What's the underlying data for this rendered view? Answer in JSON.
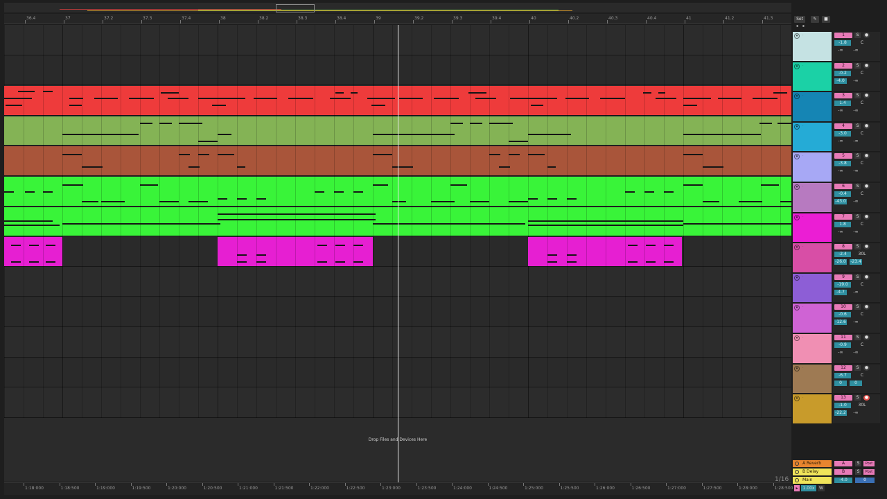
{
  "colors": {
    "accent_pink": "#e87ab7",
    "volume_teal": "#2f8fa0",
    "playhead": "#e8e8e8"
  },
  "ruler": {
    "beat_labels": [
      "36.4",
      "37",
      "37.2",
      "37.3",
      "37.4",
      "38",
      "38.2",
      "38.3",
      "38.4",
      "39",
      "39.2",
      "39.3",
      "39.4",
      "40",
      "40.2",
      "40.3",
      "40.4",
      "41",
      "41.2",
      "41.3"
    ],
    "time_labels": [
      "1:18:000",
      "1:18:500",
      "1:19:000",
      "1:19:500",
      "1:20:000",
      "1:20:500",
      "1:21:000",
      "1:21:500",
      "1:22:000",
      "1:22:500",
      "1:23:000",
      "1:23:500",
      "1:24:000",
      "1:24:500",
      "1:25:000",
      "1:25:500",
      "1:26:000",
      "1:26:500",
      "1:27:000",
      "1:27:500",
      "1:28:000",
      "1:28:500"
    ],
    "controls": {
      "set_label": "Set",
      "icon_1": "pencil-icon",
      "icon_2": "lock-icon"
    }
  },
  "arrangement": {
    "drop_hint": "Drop Files and Devices Here",
    "zoom_label": "1/16"
  },
  "tracks": [
    {
      "number": "1",
      "solo": "S",
      "volume": "-1.8",
      "pan": "C",
      "send_a": "-∞",
      "send_b": "-∞",
      "color": "#c5e2e3",
      "clip_color": null,
      "armed": false
    },
    {
      "number": "2",
      "solo": "S",
      "volume": "-0.2",
      "pan": "C",
      "send_a": "-4.0",
      "send_b": "-∞",
      "color": "#1bd1a6",
      "clip_color": null,
      "armed": false
    },
    {
      "number": "3",
      "solo": "S",
      "volume": "1.4",
      "pan": "C",
      "send_a": "-∞",
      "send_b": "-∞",
      "color": "#1585b4",
      "clip_color": "#ee3b3b",
      "armed": false,
      "meter": 0.6
    },
    {
      "number": "4",
      "solo": "S",
      "volume": "-3.0",
      "pan": "C",
      "send_a": "-∞",
      "send_b": "-∞",
      "color": "#25abd6",
      "clip_color": "#84b355",
      "armed": false,
      "meter": 0.4
    },
    {
      "number": "5",
      "solo": "S",
      "volume": "-3.8",
      "pan": "C",
      "send_a": "-∞",
      "send_b": "-∞",
      "color": "#a7a8f5",
      "clip_color": "#a9553a",
      "armed": false
    },
    {
      "number": "6",
      "solo": "S",
      "volume": "-0.4",
      "pan": "C",
      "send_a": "-43.0",
      "send_b": "-∞",
      "color": "#b77ac0",
      "clip_color": "#39f439",
      "armed": false
    },
    {
      "number": "7",
      "solo": "S",
      "volume": "1.8",
      "pan": "C",
      "send_a": "-∞",
      "send_b": "-∞",
      "color": "#eb1ed4",
      "clip_color": "#39f439",
      "armed": false
    },
    {
      "number": "8",
      "solo": "S",
      "volume": "-2.4",
      "pan": "30L",
      "send_a": "-26.0",
      "send_b": "-23.4",
      "color": "#d84ea6",
      "clip_color": "#e61fd2",
      "armed": false,
      "meter": 0.5
    },
    {
      "number": "9",
      "solo": "S",
      "volume": "-19.0",
      "pan": "C",
      "send_a": "-4.7",
      "send_b": "-∞",
      "color": "#8d5ed6",
      "clip_color": null,
      "armed": false
    },
    {
      "number": "10",
      "solo": "S",
      "volume": "-0.6",
      "pan": "C",
      "send_a": "-12.6",
      "send_b": "-∞",
      "color": "#cf63d4",
      "clip_color": null,
      "armed": false
    },
    {
      "number": "11",
      "solo": "S",
      "volume": "-0.9",
      "pan": "C",
      "send_a": "-∞",
      "send_b": "-∞",
      "color": "#f08fb3",
      "clip_color": null,
      "armed": false
    },
    {
      "number": "12",
      "solo": "S",
      "volume": "-6.7",
      "pan": "C",
      "send_a": "0",
      "send_b": "0",
      "color": "#9e7a53",
      "clip_color": null,
      "armed": false
    },
    {
      "number": "13",
      "solo": "S",
      "volume": "-1.0",
      "pan": "30L",
      "send_a": "-22.2",
      "send_b": "-∞",
      "color": "#c89b2b",
      "clip_color": null,
      "armed": true
    }
  ],
  "returns": [
    {
      "name": "A Reverb",
      "letter": "A",
      "solo": "S",
      "post": "Post",
      "color": "#e8852f"
    },
    {
      "name": "B Delay",
      "letter": "B",
      "solo": "S",
      "post": "Post",
      "color": "#f0e45a"
    }
  ],
  "main": {
    "name": "Main",
    "volume": "-4.0",
    "value2": "0",
    "color": "#f0e45a"
  },
  "bottom_bar": {
    "zoom": "1.00x",
    "w_label": "W"
  }
}
